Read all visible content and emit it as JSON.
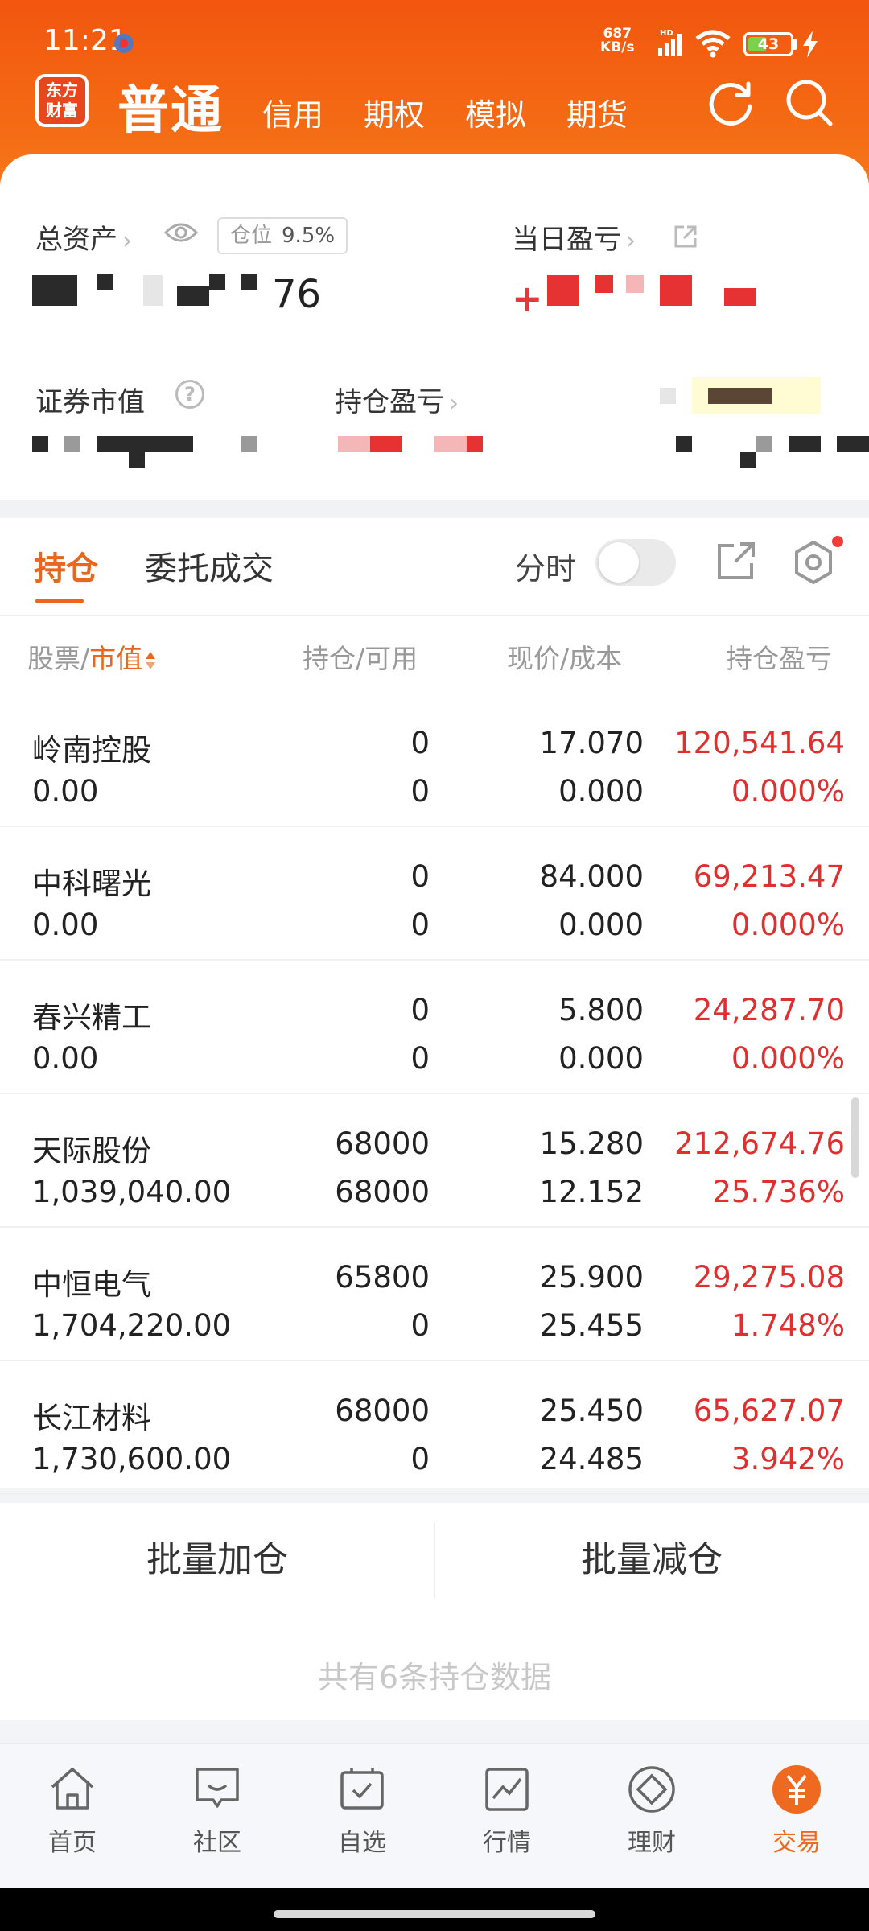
{
  "status_bar": {
    "time": "11:21",
    "net_speed_value": "687",
    "net_speed_unit": "KB/s",
    "signal_tag": "HD",
    "battery": "43",
    "battery_fraction": 0.43
  },
  "header": {
    "logo_line1": "东方",
    "logo_line2": "财富",
    "active_tab": "普通",
    "tabs": [
      "信用",
      "期权",
      "模拟",
      "期货"
    ],
    "icons": [
      "refresh-icon",
      "search-icon"
    ]
  },
  "summary": {
    "total_assets_label": "总资产",
    "position_label": "仓位",
    "position_value": "9.5%",
    "total_assets_visible_tail": "76",
    "daily_pnl_label": "当日盈亏",
    "daily_pnl_sign": "+",
    "securities_value_label": "证券市值",
    "holding_pnl_label": "持仓盈亏"
  },
  "tabs": {
    "holdings": "持仓",
    "orders": "委托成交",
    "timeshare_label": "分时",
    "timeshare_on": false
  },
  "table": {
    "headers": {
      "stock": "股票",
      "market_value": "市值",
      "position_available": "持仓/可用",
      "price_cost": "现价/成本",
      "holding_pnl": "持仓盈亏"
    },
    "rows": [
      {
        "name": "岭南控股",
        "market_value": "0.00",
        "position": "0",
        "available": "0",
        "price": "17.070",
        "cost": "0.000",
        "pnl": "120,541.64",
        "pnl_pct": "0.000%"
      },
      {
        "name": "中科曙光",
        "market_value": "0.00",
        "position": "0",
        "available": "0",
        "price": "84.000",
        "cost": "0.000",
        "pnl": "69,213.47",
        "pnl_pct": "0.000%"
      },
      {
        "name": "春兴精工",
        "market_value": "0.00",
        "position": "0",
        "available": "0",
        "price": "5.800",
        "cost": "0.000",
        "pnl": "24,287.70",
        "pnl_pct": "0.000%"
      },
      {
        "name": "天际股份",
        "market_value": "1,039,040.00",
        "position": "68000",
        "available": "68000",
        "price": "15.280",
        "cost": "12.152",
        "pnl": "212,674.76",
        "pnl_pct": "25.736%"
      },
      {
        "name": "中恒电气",
        "market_value": "1,704,220.00",
        "position": "65800",
        "available": "0",
        "price": "25.900",
        "cost": "25.455",
        "pnl": "29,275.08",
        "pnl_pct": "1.748%"
      },
      {
        "name": "长江材料",
        "market_value": "1,730,600.00",
        "position": "68000",
        "available": "0",
        "price": "25.450",
        "cost": "24.485",
        "pnl": "65,627.07",
        "pnl_pct": "3.942%"
      }
    ]
  },
  "actions": {
    "batch_add": "批量加仓",
    "batch_reduce": "批量减仓"
  },
  "footer_note": "共有6条持仓数据",
  "bottom_nav": [
    {
      "label": "首页",
      "icon": "home-icon",
      "active": false
    },
    {
      "label": "社区",
      "icon": "chat-icon",
      "active": false
    },
    {
      "label": "自选",
      "icon": "favorites-icon",
      "active": false
    },
    {
      "label": "行情",
      "icon": "chart-icon",
      "active": false
    },
    {
      "label": "理财",
      "icon": "diamond-icon",
      "active": false
    },
    {
      "label": "交易",
      "icon": "yuan-icon",
      "active": true
    }
  ],
  "colors": {
    "brand_orange": "#f2560f",
    "accent": "#e8661d",
    "profit_red": "#e02f2f"
  }
}
